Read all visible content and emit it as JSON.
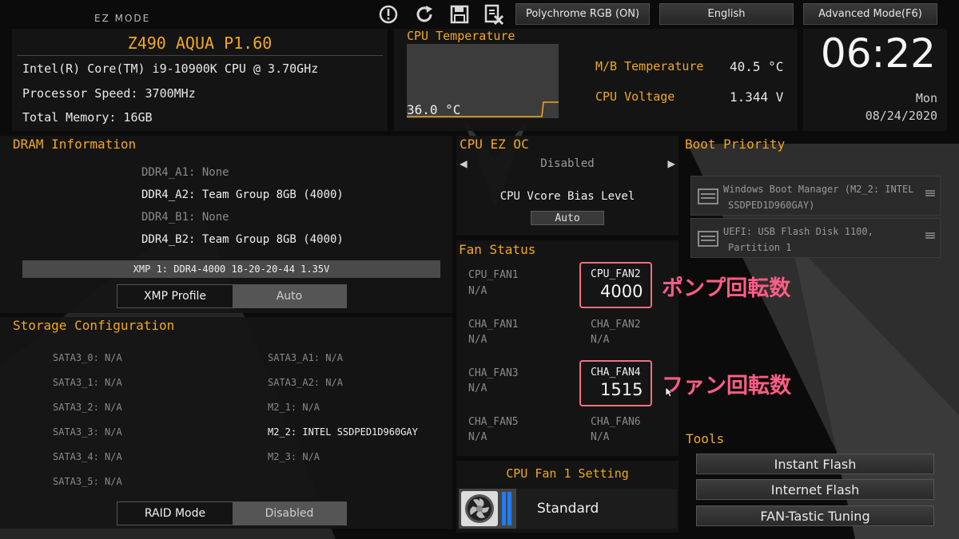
{
  "header": {
    "mode": "EZ MODE",
    "polychrome_label": "Polychrome RGB (ON)",
    "language_label": "English",
    "advanced_label": "Advanced Mode(F6)"
  },
  "sysinfo": {
    "board": "Z490 AQUA P1.60",
    "cpu": "Intel(R) Core(TM) i9-10900K CPU @ 3.70GHz",
    "speed": "Processor Speed: 3700MHz",
    "memory": "Total Memory: 16GB"
  },
  "cpu_temp": {
    "title": "CPU Temperature",
    "value": "36.0 °C",
    "mb_label": "M/B Temperature",
    "mb_value": "40.5 °C",
    "volt_label": "CPU Voltage",
    "volt_value": "1.344 V"
  },
  "clock": {
    "time": "06:22",
    "day": "Mon",
    "date": "08/24/2020"
  },
  "dram": {
    "title": "DRAM Information",
    "slots": [
      {
        "text": "DDR4_A1: None"
      },
      {
        "text": "DDR4_A2: Team Group 8GB (4000)"
      },
      {
        "text": "DDR4_B1: None"
      },
      {
        "text": "DDR4_B2: Team Group 8GB (4000)"
      }
    ],
    "xmp_line": "XMP 1: DDR4-4000 18-20-20-44 1.35V",
    "xmp_label": "XMP Profile",
    "xmp_value": "Auto"
  },
  "storage": {
    "title": "Storage Configuration",
    "left": [
      "SATA3_0: N/A",
      "SATA3_1: N/A",
      "SATA3_2: N/A",
      "SATA3_3: N/A",
      "SATA3_4: N/A",
      "SATA3_5: N/A"
    ],
    "right": [
      "SATA3_A1: N/A",
      "SATA3_A2: N/A",
      "M2_1: N/A",
      "M2_2: INTEL SSDPED1D960GAY",
      "M2_3: N/A"
    ],
    "raid_label": "RAID Mode",
    "raid_value": "Disabled"
  },
  "cpu_oc": {
    "title": "CPU EZ OC",
    "value": "Disabled",
    "vcore_label": "CPU Vcore Bias Level",
    "vcore_value": "Auto"
  },
  "fan": {
    "title": "Fan Status",
    "fans": [
      {
        "name": "CPU_FAN1",
        "value": "N/A"
      },
      {
        "name": "CPU_FAN2",
        "value": "4000"
      },
      {
        "name": "CHA_FAN1",
        "value": "N/A"
      },
      {
        "name": "CHA_FAN2",
        "value": "N/A"
      },
      {
        "name": "CHA_FAN3",
        "value": "N/A"
      },
      {
        "name": "CHA_FAN4",
        "value": "1515"
      },
      {
        "name": "CHA_FAN5",
        "value": "N/A"
      },
      {
        "name": "CHA_FAN6",
        "value": "N/A"
      }
    ],
    "setting_title": "CPU Fan 1 Setting",
    "setting_value": "Standard"
  },
  "annotations": {
    "pump": "ポンプ回転数",
    "fan": "ファン回転数"
  },
  "boot": {
    "title": "Boot Priority",
    "items": [
      {
        "line1": "Windows Boot Manager (M2_2: INTEL",
        "line2": "SSDPED1D960GAY)"
      },
      {
        "line1": "UEFI: USB Flash Disk 1100,",
        "line2": "Partition 1"
      }
    ]
  },
  "tools": {
    "title": "Tools",
    "items": [
      "Instant Flash",
      "Internet Flash",
      "FAN-Tastic Tuning"
    ]
  },
  "colors": {
    "accent": "#f2a81f",
    "annotation": "#ff5d86",
    "fan_bar": "#1f7cff"
  }
}
